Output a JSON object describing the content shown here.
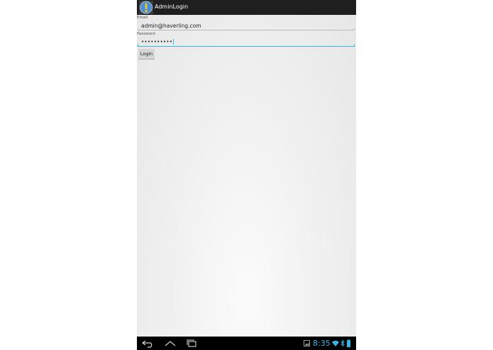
{
  "app": {
    "title": "AdminLogin",
    "icon": "app-info-icon"
  },
  "form": {
    "email_label": "Email",
    "email_value": "admin@haverling.com",
    "password_label": "Password",
    "password_value": "••••••••••",
    "login_label": "Login"
  },
  "status_bar": {
    "time": "8:35",
    "icons": [
      "screenshot-icon",
      "wifi-icon",
      "bluetooth-icon",
      "battery-icon"
    ]
  },
  "navigation": {
    "buttons": [
      "back-icon",
      "home-icon",
      "recents-icon"
    ]
  },
  "colors": {
    "action_bar": "#1f1f1f",
    "accent": "#33b5e5",
    "nav_bar": "#000000"
  }
}
